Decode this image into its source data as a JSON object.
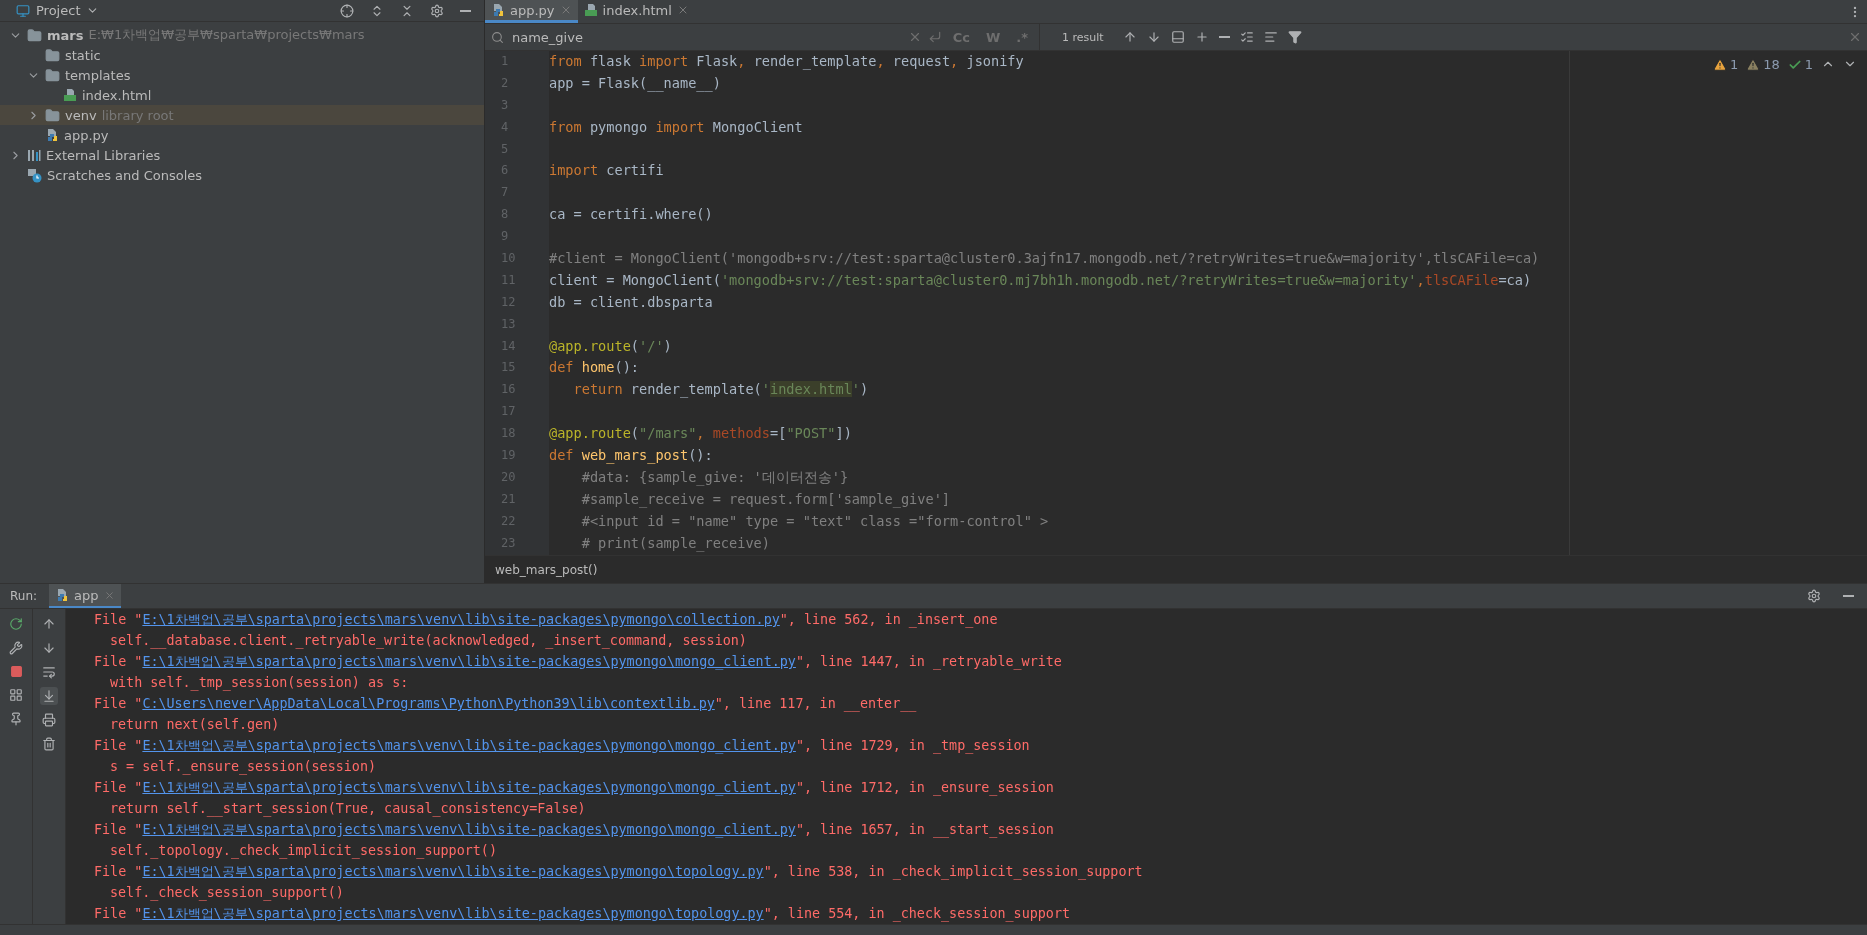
{
  "project_panel": {
    "title": "Project",
    "tree": [
      {
        "label": "mars",
        "hint": "E:₩1차백업₩공부₩sparta₩projects₩mars",
        "kind": "project",
        "expanded": true,
        "selected": false,
        "children": [
          {
            "label": "static",
            "kind": "folder",
            "selected": false
          },
          {
            "label": "templates",
            "kind": "folder",
            "expanded": true,
            "selected": false,
            "children": [
              {
                "label": "index.html",
                "kind": "html",
                "selected": false
              }
            ]
          },
          {
            "label": "venv",
            "hint": "library root",
            "kind": "folder",
            "expanded": false,
            "selected": true
          },
          {
            "label": "app.py",
            "kind": "python",
            "selected": false
          }
        ]
      },
      {
        "label": "External Libraries",
        "kind": "libraries",
        "expanded": false,
        "selected": false
      },
      {
        "label": "Scratches and Consoles",
        "kind": "scratches",
        "selected": false
      }
    ]
  },
  "editor": {
    "tabs": [
      {
        "label": "app.py",
        "kind": "python",
        "selected": true
      },
      {
        "label": "index.html",
        "kind": "html",
        "selected": false
      }
    ],
    "search": {
      "value": "name_give",
      "options": [
        "Cc",
        "W",
        ".*"
      ],
      "result": "1 result"
    },
    "inspections": [
      {
        "kind": "warning",
        "count": "1"
      },
      {
        "kind": "weak",
        "count": "18"
      },
      {
        "kind": "typo",
        "count": "1"
      }
    ],
    "lines": [
      {
        "n": "1",
        "tokens": [
          {
            "kind": "kw",
            "t": "from"
          },
          {
            "kind": "plain",
            "t": " flask "
          },
          {
            "kind": "kw",
            "t": "import"
          },
          {
            "kind": "plain",
            "t": " Flask"
          },
          {
            "kind": "kw",
            "t": ","
          },
          {
            "kind": "plain",
            "t": " render_template"
          },
          {
            "kind": "kw",
            "t": ","
          },
          {
            "kind": "plain",
            "t": " request"
          },
          {
            "kind": "kw",
            "t": ","
          },
          {
            "kind": "plain",
            "t": " jsonify"
          }
        ]
      },
      {
        "n": "2",
        "tokens": [
          {
            "kind": "plain",
            "t": "app = Flask(__name__)"
          }
        ]
      },
      {
        "n": "3"
      },
      {
        "n": "4",
        "tokens": [
          {
            "kind": "kw",
            "t": "from"
          },
          {
            "kind": "plain",
            "t": " pymongo "
          },
          {
            "kind": "kw",
            "t": "import"
          },
          {
            "kind": "plain",
            "t": " MongoClient"
          }
        ]
      },
      {
        "n": "5"
      },
      {
        "n": "6",
        "tokens": [
          {
            "kind": "kw",
            "t": "import"
          },
          {
            "kind": "plain",
            "t": " certifi"
          }
        ]
      },
      {
        "n": "7"
      },
      {
        "n": "8",
        "tokens": [
          {
            "kind": "plain",
            "t": "ca = certifi.where()"
          }
        ]
      },
      {
        "n": "9"
      },
      {
        "n": "10",
        "tokens": [
          {
            "kind": "comment",
            "t": "#client = MongoClient('mongodb+srv://test:sparta@cluster0.3ajfn17.mongodb.net/?retryWrites=true&w=majority',tlsCAFile=ca)"
          }
        ]
      },
      {
        "n": "11",
        "tokens": [
          {
            "kind": "plain",
            "t": "client = MongoClient("
          },
          {
            "kind": "str",
            "t": "'mongodb+srv://test:sparta@cluster0.mj7bh1h.mongodb.net/?retryWrites=true&w=majority'"
          },
          {
            "kind": "kw",
            "t": ","
          },
          {
            "kind": "param",
            "t": "tlsCAFile"
          },
          {
            "kind": "plain",
            "t": "=ca)"
          }
        ]
      },
      {
        "n": "12",
        "tokens": [
          {
            "kind": "plain",
            "t": "db = client.dbsparta"
          }
        ]
      },
      {
        "n": "13"
      },
      {
        "n": "14",
        "tokens": [
          {
            "kind": "deco",
            "t": "@app.route"
          },
          {
            "kind": "plain",
            "t": "("
          },
          {
            "kind": "str",
            "t": "'/'"
          },
          {
            "kind": "plain",
            "t": ")"
          }
        ]
      },
      {
        "n": "15",
        "tokens": [
          {
            "kind": "kw",
            "t": "def "
          },
          {
            "kind": "fn",
            "t": "home"
          },
          {
            "kind": "plain",
            "t": "():"
          }
        ]
      },
      {
        "n": "16",
        "tokens": [
          {
            "kind": "kw",
            "t": "   return"
          },
          {
            "kind": "plain",
            "t": " render_template("
          },
          {
            "kind": "str",
            "t": "'"
          },
          {
            "kind": "match",
            "t": "index.html"
          },
          {
            "kind": "str",
            "t": "'"
          },
          {
            "kind": "plain",
            "t": ")"
          }
        ]
      },
      {
        "n": "17"
      },
      {
        "n": "18",
        "tokens": [
          {
            "kind": "deco",
            "t": "@app.route"
          },
          {
            "kind": "plain",
            "t": "("
          },
          {
            "kind": "str",
            "t": "\"/mars\""
          },
          {
            "kind": "kw",
            "t": ", "
          },
          {
            "kind": "param",
            "t": "methods"
          },
          {
            "kind": "plain",
            "t": "=["
          },
          {
            "kind": "str",
            "t": "\"POST\""
          },
          {
            "kind": "plain",
            "t": "])"
          }
        ]
      },
      {
        "n": "19",
        "tokens": [
          {
            "kind": "kw",
            "t": "def "
          },
          {
            "kind": "fn",
            "t": "web_mars_post"
          },
          {
            "kind": "plain",
            "t": "():"
          }
        ]
      },
      {
        "n": "20",
        "tokens": [
          {
            "kind": "comment",
            "t": "    #data: {sample_give: '데이터전송'}"
          }
        ]
      },
      {
        "n": "21",
        "tokens": [
          {
            "kind": "comment",
            "t": "    #sample_receive = request.form['sample_give']"
          }
        ]
      },
      {
        "n": "22",
        "tokens": [
          {
            "kind": "comment",
            "t": "    #<input id = \"name\" type = \"text\" class =\"form-control\" >"
          }
        ]
      },
      {
        "n": "23",
        "tokens": [
          {
            "kind": "comment",
            "t": "    # print(sample_receive)"
          }
        ]
      }
    ],
    "breadcrumb": "web_mars_post()"
  },
  "run_panel": {
    "label": "Run:",
    "tab": "app",
    "output": [
      {
        "kind": "file",
        "before": "File \"",
        "link": "E:\\1차백업\\공부\\sparta\\projects\\mars\\venv\\lib\\site-packages\\pymongo\\collection.py",
        "after": "\", line 562, in _insert_one"
      },
      {
        "kind": "code",
        "text": "self.__database.client._retryable_write(acknowledged, _insert_command, session)"
      },
      {
        "kind": "file",
        "before": "File \"",
        "link": "E:\\1차백업\\공부\\sparta\\projects\\mars\\venv\\lib\\site-packages\\pymongo\\mongo_client.py",
        "after": "\", line 1447, in _retryable_write"
      },
      {
        "kind": "code",
        "text": "with self._tmp_session(session) as s:"
      },
      {
        "kind": "file",
        "before": "File \"",
        "link": "C:\\Users\\never\\AppData\\Local\\Programs\\Python\\Python39\\lib\\contextlib.py",
        "after": "\", line 117, in __enter__"
      },
      {
        "kind": "code",
        "text": "return next(self.gen)"
      },
      {
        "kind": "file",
        "before": "File \"",
        "link": "E:\\1차백업\\공부\\sparta\\projects\\mars\\venv\\lib\\site-packages\\pymongo\\mongo_client.py",
        "after": "\", line 1729, in _tmp_session"
      },
      {
        "kind": "code",
        "text": "s = self._ensure_session(session)"
      },
      {
        "kind": "file",
        "before": "File \"",
        "link": "E:\\1차백업\\공부\\sparta\\projects\\mars\\venv\\lib\\site-packages\\pymongo\\mongo_client.py",
        "after": "\", line 1712, in _ensure_session"
      },
      {
        "kind": "code",
        "text": "return self.__start_session(True, causal_consistency=False)"
      },
      {
        "kind": "file",
        "before": "File \"",
        "link": "E:\\1차백업\\공부\\sparta\\projects\\mars\\venv\\lib\\site-packages\\pymongo\\mongo_client.py",
        "after": "\", line 1657, in __start_session"
      },
      {
        "kind": "code",
        "text": "self._topology._check_implicit_session_support()"
      },
      {
        "kind": "file",
        "before": "File \"",
        "link": "E:\\1차백업\\공부\\sparta\\projects\\mars\\venv\\lib\\site-packages\\pymongo\\topology.py",
        "after": "\", line 538, in _check_implicit_session_support"
      },
      {
        "kind": "code",
        "text": "self._check_session_support()"
      },
      {
        "kind": "file",
        "before": "File \"",
        "link": "E:\\1차백업\\공부\\sparta\\projects\\mars\\venv\\lib\\site-packages\\pymongo\\topology.py",
        "after": "\", line 554, in _check_session_support"
      }
    ]
  }
}
